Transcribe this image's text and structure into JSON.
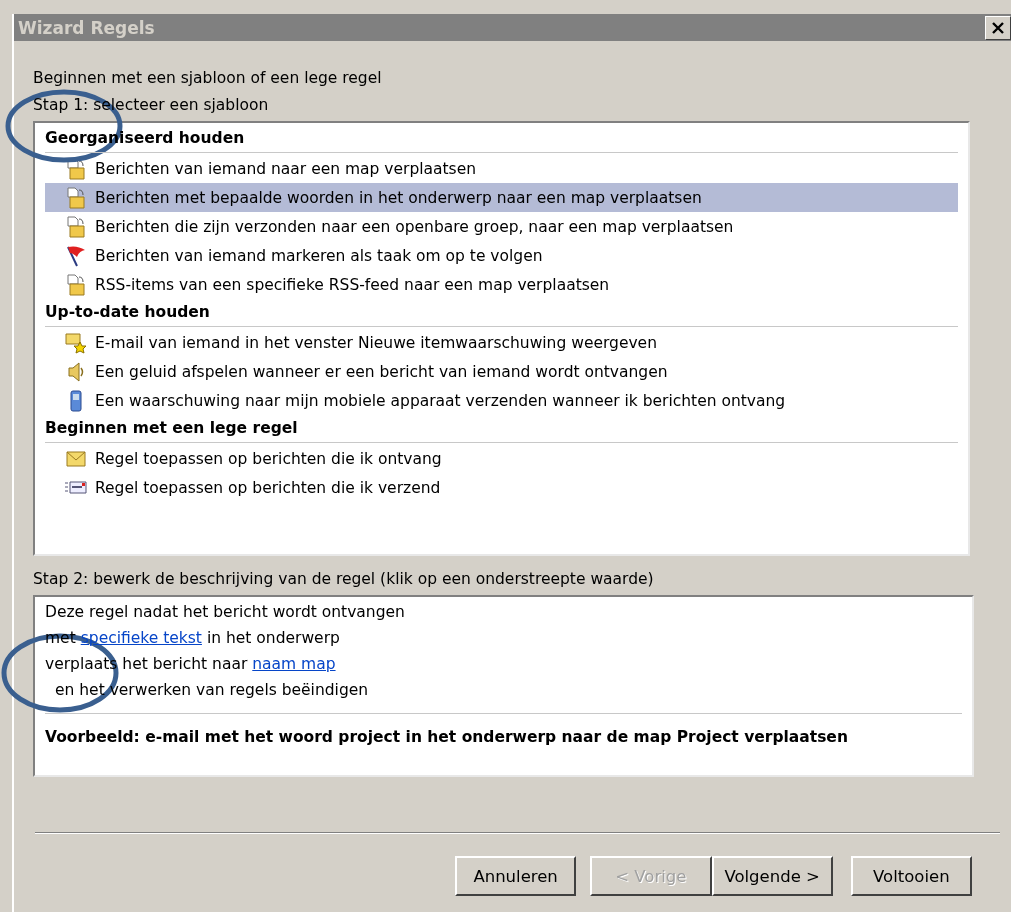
{
  "window": {
    "title": "Wizard Regels"
  },
  "intro": "Beginnen met een sjabloon of een lege regel",
  "step1": {
    "label": "Stap 1: selecteer een sjabloon",
    "groups": [
      {
        "heading": "Georganiseerd houden",
        "items": [
          {
            "kind": "folder",
            "label": "Berichten van iemand naar een map verplaatsen",
            "selected": false
          },
          {
            "kind": "folder",
            "label": "Berichten met bepaalde woorden in het onderwerp naar een map verplaatsen",
            "selected": true
          },
          {
            "kind": "folder",
            "label": "Berichten die zijn verzonden naar een openbare groep, naar een map verplaatsen",
            "selected": false
          },
          {
            "kind": "flag",
            "label": "Berichten van iemand markeren als taak om op te volgen",
            "selected": false
          },
          {
            "kind": "folder",
            "label": "RSS-items van een specifieke RSS-feed naar een map verplaatsen",
            "selected": false
          }
        ]
      },
      {
        "heading": "Up-to-date houden",
        "items": [
          {
            "kind": "alert",
            "label": "E-mail van iemand in het venster Nieuwe itemwaarschuwing weergeven",
            "selected": false
          },
          {
            "kind": "sound",
            "label": "Een geluid afspelen wanneer er een bericht van iemand wordt ontvangen",
            "selected": false
          },
          {
            "kind": "phone",
            "label": "Een waarschuwing naar mijn mobiele apparaat verzenden wanneer ik berichten ontvang",
            "selected": false
          }
        ]
      },
      {
        "heading": "Beginnen met een lege regel",
        "items": [
          {
            "kind": "mail",
            "label": "Regel toepassen op berichten die ik ontvang",
            "selected": false
          },
          {
            "kind": "send",
            "label": "Regel toepassen op berichten die ik verzend",
            "selected": false
          }
        ]
      }
    ]
  },
  "step2": {
    "label": "Stap 2: bewerk de beschrijving van de regel (klik op een onderstreepte waarde)",
    "lines": [
      {
        "kind": "plain",
        "parts": [
          {
            "text": "Deze regel nadat het bericht wordt ontvangen",
            "link": false
          }
        ]
      },
      {
        "kind": "plain",
        "parts": [
          {
            "text": "met",
            "link": false
          },
          {
            "text": "specifieke tekst",
            "link": true
          },
          {
            "text": "in het onderwerp",
            "link": false
          }
        ]
      },
      {
        "kind": "plain",
        "parts": [
          {
            "text": "verplaats het bericht naar",
            "link": false
          },
          {
            "text": "naam map",
            "link": true
          }
        ]
      },
      {
        "kind": "sub",
        "parts": [
          {
            "text": "en het verwerken van regels beëindigen",
            "link": false
          }
        ]
      }
    ],
    "example": "Voorbeeld: e-mail met het woord project in het onderwerp naar de map Project verplaatsen"
  },
  "buttons": [
    {
      "label": "Annuleren",
      "disabled": false,
      "joined": false
    },
    {
      "label": "< Vorige",
      "disabled": true,
      "joined": false
    },
    {
      "label": "Volgende >",
      "disabled": false,
      "joined": true
    },
    {
      "label": "Voltooien",
      "disabled": false,
      "joined": false
    }
  ]
}
